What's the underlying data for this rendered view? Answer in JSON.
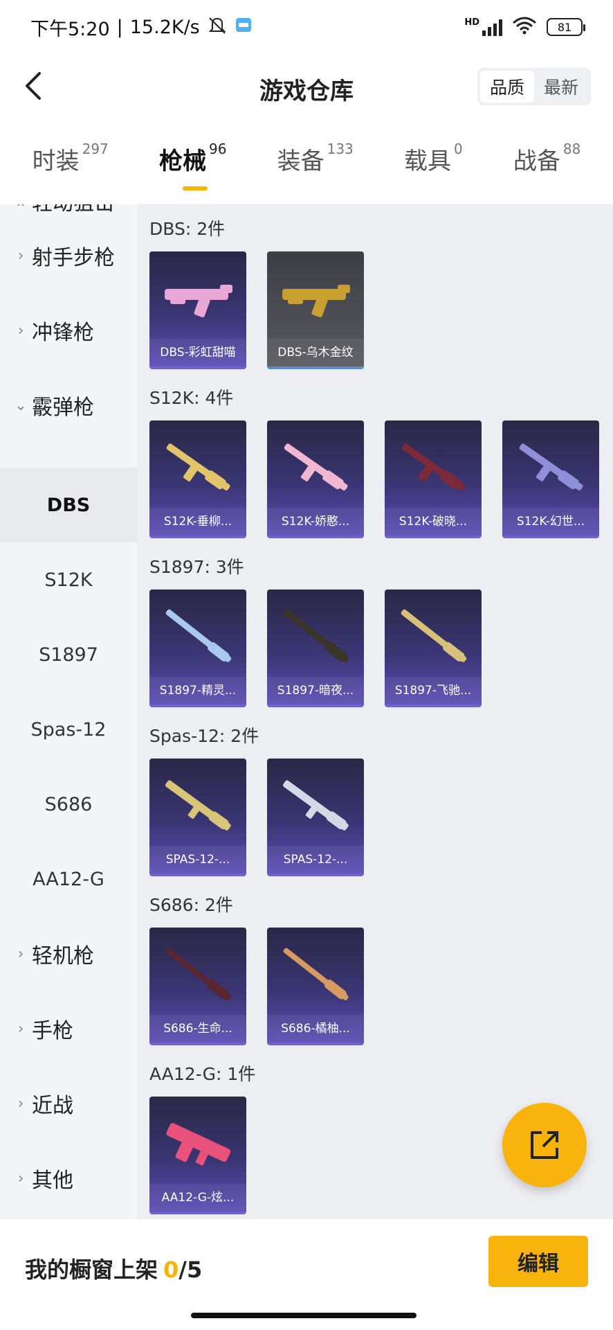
{
  "status_bar": {
    "time": "下午5:20",
    "speed": "15.2K/s",
    "network": "HD",
    "battery": "81"
  },
  "header": {
    "title": "游戏仓库",
    "sort_options": [
      "品质",
      "最新"
    ],
    "active_sort": "品质"
  },
  "tabs": [
    {
      "label": "时装",
      "count": "297"
    },
    {
      "label": "枪械",
      "count": "96",
      "active": true
    },
    {
      "label": "装备",
      "count": "133"
    },
    {
      "label": "载具",
      "count": "0"
    },
    {
      "label": "战备",
      "count": "88"
    }
  ],
  "sidebar": {
    "items": [
      {
        "label": "轻动狙击",
        "type": "category",
        "chevron": "up"
      },
      {
        "label": "射手步枪",
        "type": "category",
        "chevron": "right"
      },
      {
        "label": "冲锋枪",
        "type": "category",
        "chevron": "right"
      },
      {
        "label": "霰弹枪",
        "type": "category",
        "chevron": "down"
      },
      {
        "label": "DBS",
        "type": "sub",
        "selected": true
      },
      {
        "label": "S12K",
        "type": "sub"
      },
      {
        "label": "S1897",
        "type": "sub"
      },
      {
        "label": "Spas-12",
        "type": "sub"
      },
      {
        "label": "S686",
        "type": "sub"
      },
      {
        "label": "AA12-G",
        "type": "sub"
      },
      {
        "label": "轻机枪",
        "type": "category",
        "chevron": "right"
      },
      {
        "label": "手枪",
        "type": "category",
        "chevron": "right"
      },
      {
        "label": "近战",
        "type": "category",
        "chevron": "right"
      },
      {
        "label": "其他",
        "type": "category",
        "chevron": "right"
      }
    ]
  },
  "groups": [
    {
      "title": "DBS: 2件",
      "items": [
        {
          "name": "DBS-彩虹甜喵",
          "color": "#e9a7d6",
          "style": "purple"
        },
        {
          "name": "DBS-乌木金纹",
          "color": "#c8a032",
          "style": "grey"
        }
      ]
    },
    {
      "title": "S12K: 4件",
      "items": [
        {
          "name": "S12K-垂柳...",
          "color": "#e2c56a"
        },
        {
          "name": "S12K-娇憨...",
          "color": "#f0b7d0"
        },
        {
          "name": "S12K-破晓...",
          "color": "#7c2a3a"
        },
        {
          "name": "S12K-幻世...",
          "color": "#8d8fd8"
        }
      ]
    },
    {
      "title": "S1897: 3件",
      "items": [
        {
          "name": "S1897-精灵...",
          "color": "#a9c8ee"
        },
        {
          "name": "S1897-暗夜...",
          "color": "#3a3525"
        },
        {
          "name": "S1897-飞驰...",
          "color": "#d8c07a"
        }
      ]
    },
    {
      "title": "Spas-12: 2件",
      "items": [
        {
          "name": "SPAS-12-...",
          "color": "#d9c57a"
        },
        {
          "name": "SPAS-12-...",
          "color": "#d5d9e6"
        }
      ]
    },
    {
      "title": "S686: 2件",
      "items": [
        {
          "name": "S686-生命...",
          "color": "#5a2630"
        },
        {
          "name": "S686-橘柚...",
          "color": "#d99a62"
        }
      ]
    },
    {
      "title": "AA12-G: 1件",
      "items": [
        {
          "name": "AA12-G-炫...",
          "color": "#e8527a"
        }
      ]
    }
  ],
  "bottom": {
    "shelf_label": "我的橱窗上架",
    "shelf_count": "0",
    "shelf_total": "/5",
    "edit_label": "编辑"
  }
}
